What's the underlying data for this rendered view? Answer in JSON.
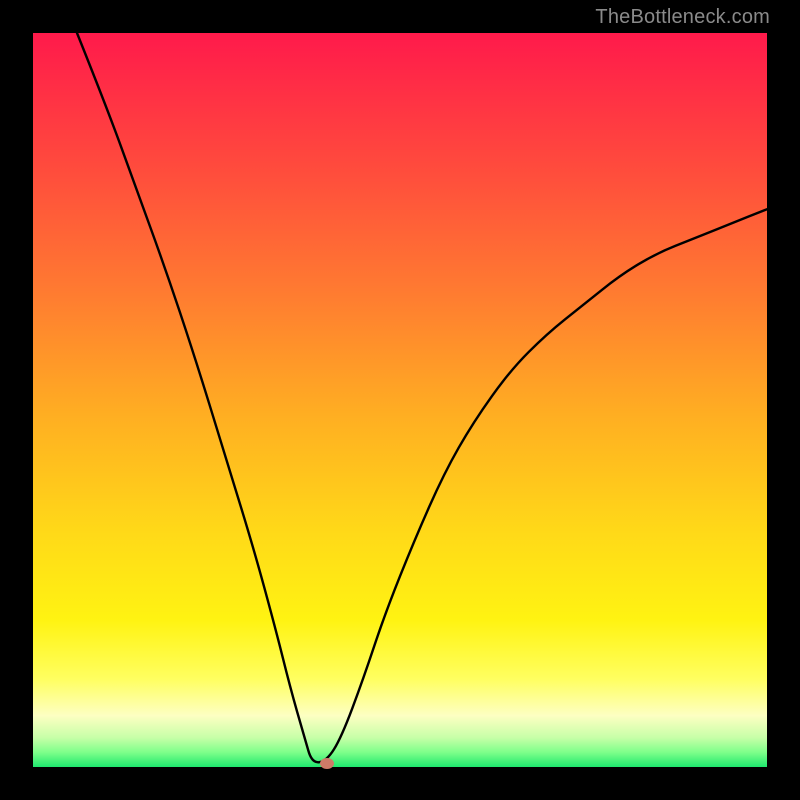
{
  "watermark": "TheBottleneck.com",
  "chart_data": {
    "type": "line",
    "title": "",
    "xlabel": "",
    "ylabel": "",
    "xlim": [
      0,
      100
    ],
    "ylim": [
      0,
      100
    ],
    "background_gradient": {
      "top": "#ff1a4b",
      "bottom": "#1ee86e",
      "note": "red (high bottleneck) at top → green (no bottleneck) at bottom"
    },
    "description": "V-shaped bottleneck curve. The curve falls from top-left to a minimum near x≈38 (y≈0), then rises toward the right reaching about y≈76 at x=100.",
    "series": [
      {
        "name": "bottleneck-curve",
        "x": [
          6,
          10,
          14,
          18,
          22,
          26,
          30,
          33,
          35,
          37,
          38,
          40,
          42,
          45,
          48,
          52,
          56,
          60,
          65,
          70,
          75,
          80,
          85,
          90,
          95,
          100
        ],
        "y": [
          100,
          90,
          79,
          68,
          56,
          43,
          30,
          19,
          11,
          4,
          0.5,
          0.8,
          4,
          12,
          21,
          31,
          40,
          47,
          54,
          59,
          63,
          67,
          70,
          72,
          74,
          76
        ]
      }
    ],
    "markers": [
      {
        "name": "optimal-point",
        "x": 40,
        "y": 0.5,
        "color": "#cf7a68"
      }
    ],
    "colors": {
      "curve": "#000000",
      "frame": "#000000"
    }
  }
}
